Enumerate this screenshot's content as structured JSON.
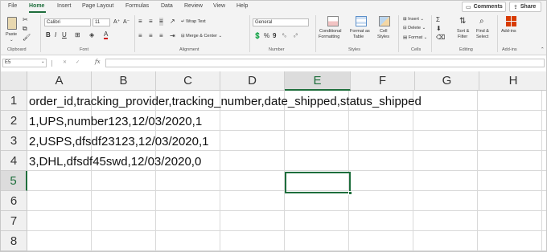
{
  "tabs": [
    "File",
    "Home",
    "Insert",
    "Page Layout",
    "Formulas",
    "Data",
    "Review",
    "View",
    "Help"
  ],
  "comments_label": "Comments",
  "share_label": "Share",
  "ribbon": {
    "clipboard": {
      "paste": "Paste",
      "label": "Clipboard"
    },
    "font": {
      "name": "Calibri",
      "size": "11",
      "label": "Font"
    },
    "alignment": {
      "wrap": "Wrap Text",
      "merge": "Merge & Center",
      "label": "Alignment"
    },
    "number": {
      "format": "General",
      "label": "Number"
    },
    "styles": {
      "conditional": "Conditional",
      "conditional2": "Formatting",
      "format_as": "Format as",
      "format_as2": "Table",
      "cell": "Cell",
      "cell2": "Styles",
      "label": "Styles"
    },
    "cells": {
      "insert": "Insert",
      "delete": "Delete",
      "format": "Format",
      "label": "Cells"
    },
    "editing": {
      "sort": "Sort &",
      "sort2": "Filter",
      "find": "Find &",
      "find2": "Select",
      "label": "Editing"
    },
    "addins": {
      "addins": "Add-ins",
      "label": "Add-ins"
    }
  },
  "formula_bar": {
    "name_box": "E5",
    "fx": "fx",
    "value": ""
  },
  "columns": [
    "A",
    "B",
    "C",
    "D",
    "E",
    "F",
    "G",
    "H"
  ],
  "rows": [
    "1",
    "2",
    "3",
    "4",
    "5",
    "6",
    "7",
    "8"
  ],
  "cells": [
    "order_id,tracking_provider,tracking_number,date_shipped,status_shipped",
    "1,UPS,number123,12/03/2020,1",
    "2,USPS,dfsdf23123,12/03/2020,1",
    "3,DHL,dfsdf45swd,12/03/2020,0"
  ],
  "selected_cell": "E5",
  "accent_color": "#1e6e3c"
}
